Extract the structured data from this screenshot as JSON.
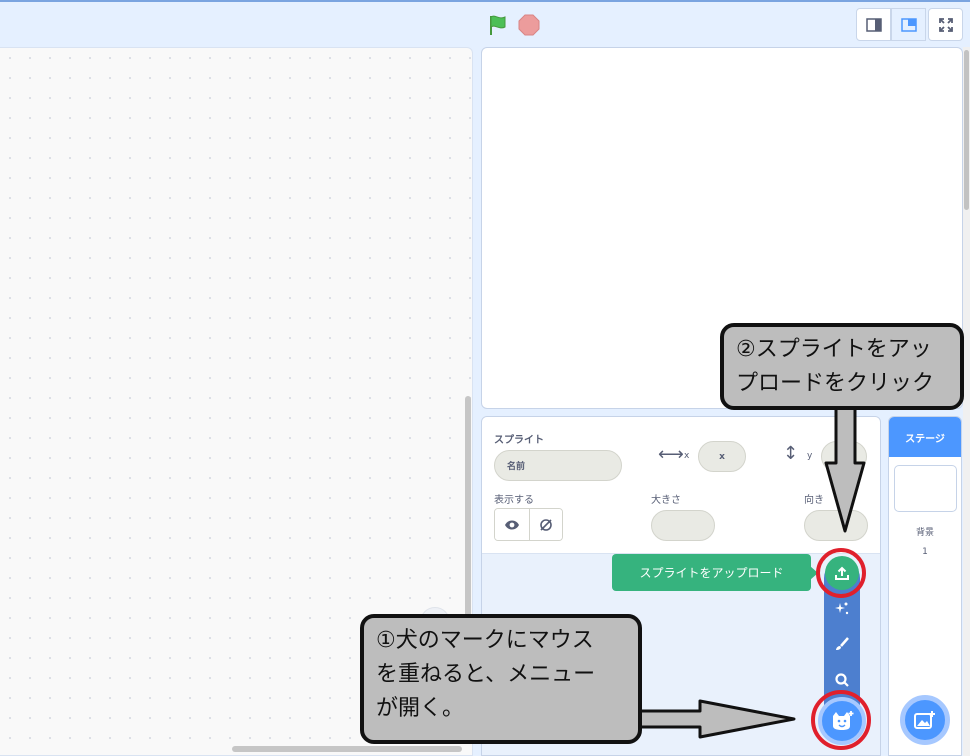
{
  "colors": {
    "accent": "#4c97ff",
    "menu": "#4d7fcf",
    "upload_green": "#36b37e",
    "highlight_red": "#e0202c",
    "callout_bg": "#bdbdbd"
  },
  "toolbar": {
    "green_flag_icon": "green-flag-icon",
    "stop_icon": "stop-icon",
    "layout_buttons": [
      "small-stage-icon",
      "normal-stage-icon",
      "fullscreen-icon"
    ]
  },
  "sprite_info": {
    "sprite_label": "スプライト",
    "name_placeholder": "名前",
    "x_label": "x",
    "x_placeholder": "x",
    "y_label": "y",
    "show_label": "表示する",
    "size_label": "大きさ",
    "direction_label": "向き"
  },
  "stage_selector": {
    "tab_label": "ステージ",
    "backdrop_label": "背景",
    "backdrop_count": "1"
  },
  "sprite_menu": {
    "tooltip": "スプライトをアップロード",
    "items": [
      "upload-icon",
      "surprise-icon",
      "paint-icon",
      "search-icon"
    ],
    "main_button_icon": "cat-icon"
  },
  "annotations": {
    "callout_1": "①犬のマークにマウス\n を重ねると、メニュー\nが開く。",
    "callout_2": "②スプライトをアッ\nプロードをクリック"
  }
}
